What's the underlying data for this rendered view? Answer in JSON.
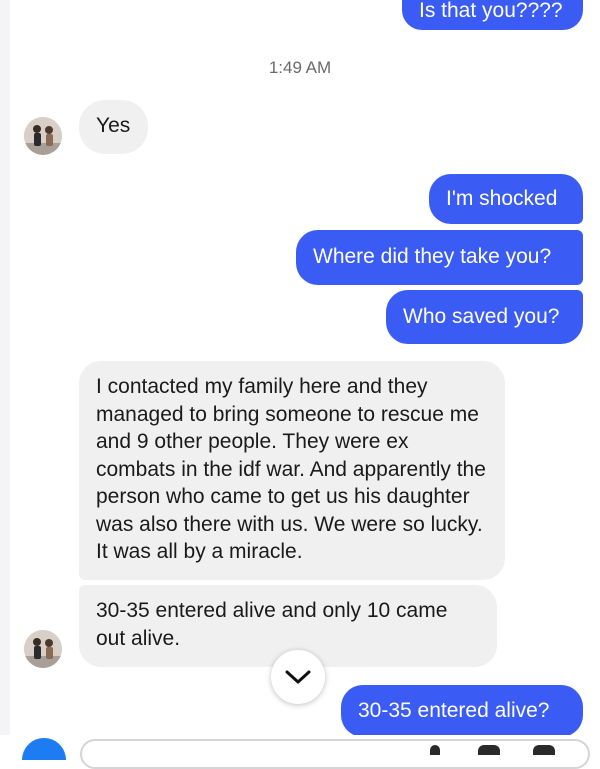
{
  "conversation": {
    "top_message": "Is that you????",
    "timestamp": "1:49 AM",
    "messages": [
      {
        "from": "other",
        "text": "Yes"
      },
      {
        "from": "me",
        "text": "I'm shocked"
      },
      {
        "from": "me",
        "text": "Where did they take you?"
      },
      {
        "from": "me",
        "text": "Who saved you?"
      },
      {
        "from": "other",
        "text": "I contacted my family here and they managed to bring someone to rescue me and 9 other people. They were ex combats in the idf war. And apparently the person who came to get us his daughter was also there with us. We were so lucky. It was all by a miracle."
      },
      {
        "from": "other",
        "text": "30-35 entered alive and only 10 came out alive."
      },
      {
        "from": "me",
        "text": "30-35 entered alive?"
      }
    ]
  },
  "icons": {
    "scroll_down": "chevron-down-icon",
    "avatar": "user-avatar"
  },
  "colors": {
    "outgoing_bubble": "#3b5bf5",
    "incoming_bubble": "#f0f0f1",
    "accent": "#1d7cf2"
  }
}
